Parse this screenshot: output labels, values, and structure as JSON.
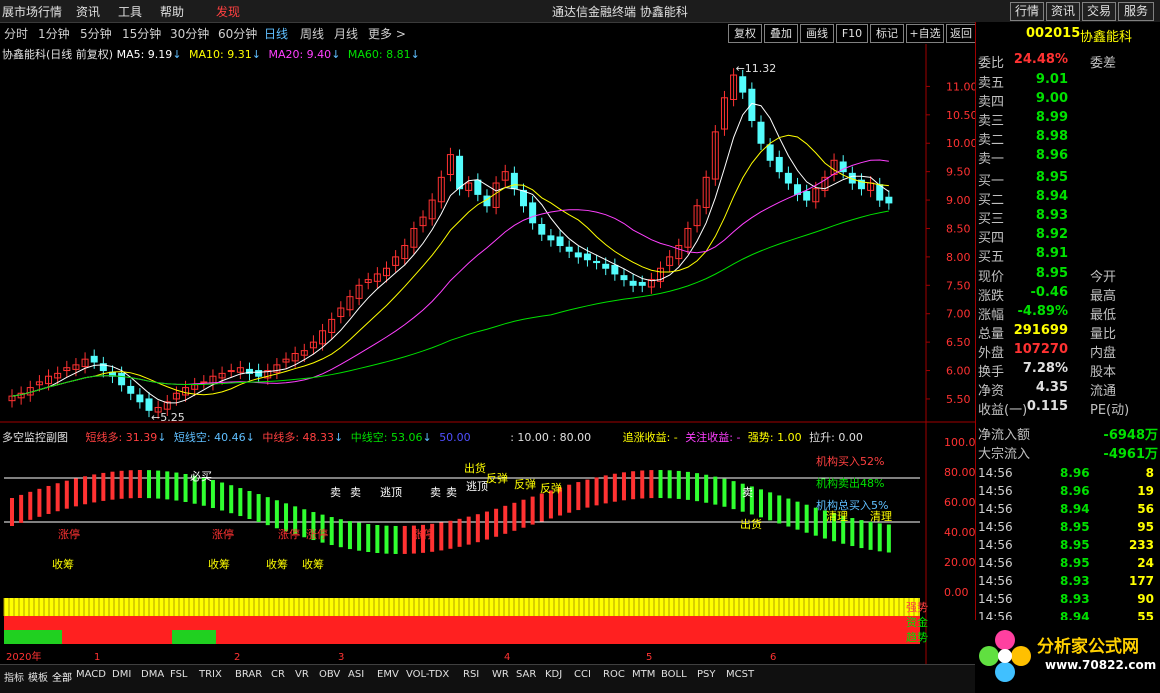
{
  "menu": {
    "items": [
      "展市场行情",
      "资讯",
      "工具",
      "帮助",
      "发现"
    ],
    "window_title": "通达信金融终端  协鑫能科",
    "right_buttons": [
      "行情",
      "资讯",
      "交易",
      "服务"
    ]
  },
  "periods": [
    "分时",
    "1分钟",
    "5分钟",
    "15分钟",
    "30分钟",
    "60分钟",
    "日线",
    "周线",
    "月线",
    "更多 >"
  ],
  "toolbar": [
    "复权",
    "叠加",
    "画线",
    "F10",
    "标记",
    "+自选",
    "返回"
  ],
  "ma_legend": {
    "name": "协鑫能科(日线 前复权)",
    "ma5": "MA5: 9.19",
    "ma10": "MA10: 9.31",
    "ma20": "MA20: 9.40",
    "ma60": "MA60: 8.81"
  },
  "colors": {
    "up": "#ff3232",
    "down": "#54fcfc",
    "ma5": "#ffffff",
    "ma10": "#ffff00",
    "ma20": "#ff40ff",
    "ma60": "#00e000",
    "accent": "#ff4040"
  },
  "chart_data": {
    "type": "candlestick",
    "y_axis_labels": [
      "11.00",
      "10.50",
      "10.00",
      "9.50",
      "9.00",
      "8.50",
      "8.00",
      "7.50",
      "7.00",
      "6.50",
      "6.00",
      "5.50"
    ],
    "ylim": [
      5.2,
      11.5
    ],
    "annotations": {
      "high": "11.32",
      "low": "5.25"
    },
    "x_labels": [
      "2020年",
      "1",
      "2",
      "3",
      "4",
      "5",
      "6"
    ],
    "closes": [
      5.55,
      5.6,
      5.7,
      5.8,
      5.9,
      5.95,
      6.05,
      6.1,
      6.2,
      6.15,
      6.0,
      5.9,
      5.75,
      5.6,
      5.45,
      5.3,
      5.35,
      5.45,
      5.6,
      5.7,
      5.75,
      5.8,
      5.9,
      5.95,
      6.0,
      6.05,
      5.95,
      5.9,
      6.0,
      6.1,
      6.2,
      6.3,
      6.35,
      6.5,
      6.7,
      6.9,
      7.1,
      7.3,
      7.5,
      7.6,
      7.7,
      7.8,
      8.0,
      8.2,
      8.5,
      8.7,
      9.0,
      9.4,
      9.8,
      9.2,
      9.3,
      9.1,
      8.9,
      9.3,
      9.5,
      9.2,
      8.9,
      8.6,
      8.4,
      8.3,
      8.2,
      8.1,
      8.0,
      7.95,
      7.9,
      7.8,
      7.7,
      7.6,
      7.5,
      7.5,
      7.6,
      7.8,
      8.0,
      8.2,
      8.5,
      8.9,
      9.4,
      10.2,
      10.8,
      11.2,
      10.9,
      10.4,
      10.0,
      9.7,
      9.5,
      9.3,
      9.1,
      9.0,
      9.2,
      9.4,
      9.7,
      9.5,
      9.3,
      9.2,
      9.3,
      9.0,
      8.95
    ],
    "sub_indicator": {
      "title": "多空监控副图",
      "labels": [
        "短线多: 31.39",
        "短线空: 40.46",
        "中线多: 48.33",
        "中线空: 53.06",
        "50.00",
        ": 10.00 : 80.00",
        "追涨收益: -",
        "关注收益: -",
        "强势: 1.00",
        "拉升: 0.00"
      ],
      "y_axis_labels": [
        "100.00",
        "80.00",
        "60.00",
        "40.00",
        "20.00",
        "0.00"
      ],
      "tags": [
        "卖",
        "卖",
        "卖",
        "卖",
        "卖",
        "逃顶",
        "逃顶",
        "出货",
        "出货",
        "反弹",
        "反弹",
        "反弹",
        "清理",
        "清理",
        "涨停",
        "涨停",
        "涨停",
        "涨停",
        "涨停",
        "收筹",
        "收筹",
        "收筹",
        "收筹",
        "必买"
      ],
      "side_texts": [
        "机构买入52%",
        "机构卖出48%",
        "机构总买入5%"
      ],
      "bottom_labels": [
        "强势",
        "资金",
        "趋势"
      ]
    }
  },
  "right_panel": {
    "code": "002015",
    "name": "协鑫能科",
    "weibi": {
      "label": "委比",
      "value": "24.48%",
      "label2": "委差"
    },
    "sells": [
      {
        "label": "卖五",
        "price": "9.01"
      },
      {
        "label": "卖四",
        "price": "9.00"
      },
      {
        "label": "卖三",
        "price": "8.99"
      },
      {
        "label": "卖二",
        "price": "8.98"
      },
      {
        "label": "卖一",
        "price": "8.96"
      }
    ],
    "buys": [
      {
        "label": "买一",
        "price": "8.95"
      },
      {
        "label": "买二",
        "price": "8.94"
      },
      {
        "label": "买三",
        "price": "8.93"
      },
      {
        "label": "买四",
        "price": "8.92"
      },
      {
        "label": "买五",
        "price": "8.91"
      }
    ],
    "stats": [
      {
        "label": "现价",
        "value": "8.95",
        "label2": "今开",
        "color": "#00e000"
      },
      {
        "label": "涨跌",
        "value": "-0.46",
        "label2": "最高",
        "color": "#00e000"
      },
      {
        "label": "涨幅",
        "value": "-4.89%",
        "label2": "最低",
        "color": "#00e000"
      },
      {
        "label": "总量",
        "value": "291699",
        "label2": "量比",
        "color": "#ffff00"
      },
      {
        "label": "外盘",
        "value": "107270",
        "label2": "内盘",
        "color": "#ff3232"
      },
      {
        "label": "换手",
        "value": "7.28%",
        "label2": "股本",
        "color": "#e0e0e0"
      },
      {
        "label": "净资",
        "value": "4.35",
        "label2": "流通",
        "color": "#e0e0e0"
      },
      {
        "label": "收益(一)",
        "value": "0.115",
        "label2": "PE(动)",
        "color": "#e0e0e0"
      }
    ],
    "flows": [
      {
        "label": "净流入额",
        "value": "-6948万"
      },
      {
        "label": "大宗流入",
        "value": "-4961万"
      }
    ],
    "ticks": [
      {
        "time": "14:56",
        "price": "8.96",
        "qty": "8"
      },
      {
        "time": "14:56",
        "price": "8.96",
        "qty": "19"
      },
      {
        "time": "14:56",
        "price": "8.94",
        "qty": "56"
      },
      {
        "time": "14:56",
        "price": "8.95",
        "qty": "95"
      },
      {
        "time": "14:56",
        "price": "8.95",
        "qty": "233"
      },
      {
        "time": "14:56",
        "price": "8.95",
        "qty": "24"
      },
      {
        "time": "14:56",
        "price": "8.93",
        "qty": "177"
      },
      {
        "time": "14:56",
        "price": "8.93",
        "qty": "90"
      },
      {
        "time": "14:56",
        "price": "8.94",
        "qty": "55"
      }
    ]
  },
  "bottom_tabs": [
    "指标",
    "模板",
    "全部",
    "MACD",
    "DMI",
    "DMA",
    "FSL",
    "TRIX",
    "BRAR",
    "CR",
    "VR",
    "OBV",
    "ASI",
    "EMV",
    "VOL-TDX",
    "RSI",
    "WR",
    "SAR",
    "KDJ",
    "CCI",
    "ROC",
    "MTM",
    "BOLL",
    "PSY",
    "MCST"
  ],
  "logo": {
    "text": "分析家公式网",
    "url": "www.70822.com"
  }
}
